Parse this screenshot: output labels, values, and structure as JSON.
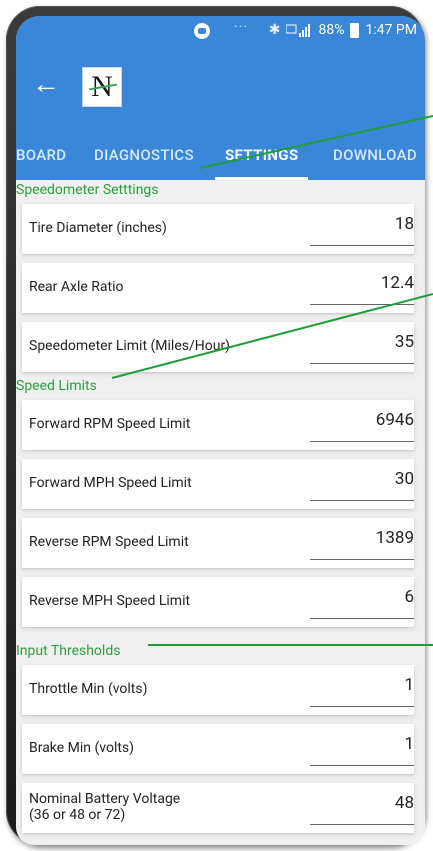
{
  "statusbar": {
    "dots": "···",
    "battery_pct": "88%",
    "time": "1:47 PM"
  },
  "appbar": {
    "logo_letter": "N"
  },
  "tabs": [
    "BOARD",
    "DIAGNOSTICS",
    "SETTINGS",
    "DOWNLOAD"
  ],
  "sections": [
    {
      "title": "Speedometer Setttings",
      "rows": [
        {
          "label": "Tire Diameter (inches)",
          "value": "18"
        },
        {
          "label": "Rear Axle Ratio",
          "value": "12.4"
        },
        {
          "label": "Speedometer Limit (Miles/Hour)",
          "value": "35"
        }
      ]
    },
    {
      "title": "Speed Limits",
      "rows": [
        {
          "label": "Forward RPM Speed Limit",
          "value": "6946"
        },
        {
          "label": "Forward MPH Speed Limit",
          "value": "30"
        },
        {
          "label": "Reverse RPM Speed Limit",
          "value": "1389"
        },
        {
          "label": "Reverse MPH Speed Limit",
          "value": "6"
        }
      ]
    },
    {
      "title": "Input Thresholds",
      "rows": [
        {
          "label": "Throttle Min (volts)",
          "value": "1"
        },
        {
          "label": "Brake Min (volts)",
          "value": "1"
        },
        {
          "label_line1": "Nominal Battery Voltage",
          "label_line2": "(36 or 48 or 72)",
          "value": "48"
        }
      ]
    }
  ],
  "colors": {
    "appbar": "#3a86d8",
    "section_title": "#2b9f3c",
    "callout": "#1e9f3a"
  }
}
